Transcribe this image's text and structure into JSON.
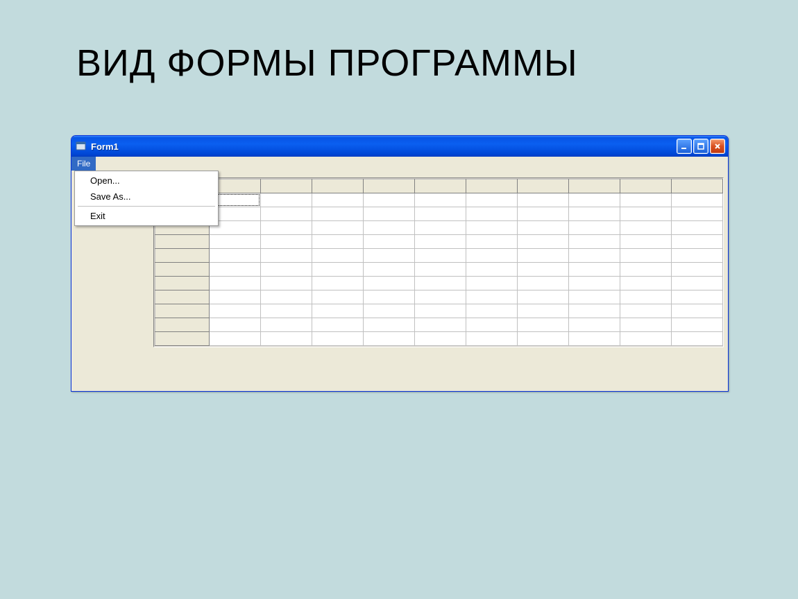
{
  "slide": {
    "title": "ВИД ФОРМЫ ПРОГРАММЫ"
  },
  "window": {
    "title": "Form1"
  },
  "menubar": {
    "file": "File"
  },
  "file_menu": {
    "open": "Open...",
    "save_as": "Save As...",
    "exit": "Exit"
  },
  "grid": {
    "columns": 11,
    "rows": 11,
    "selected": {
      "row": 1,
      "col": 1
    }
  }
}
